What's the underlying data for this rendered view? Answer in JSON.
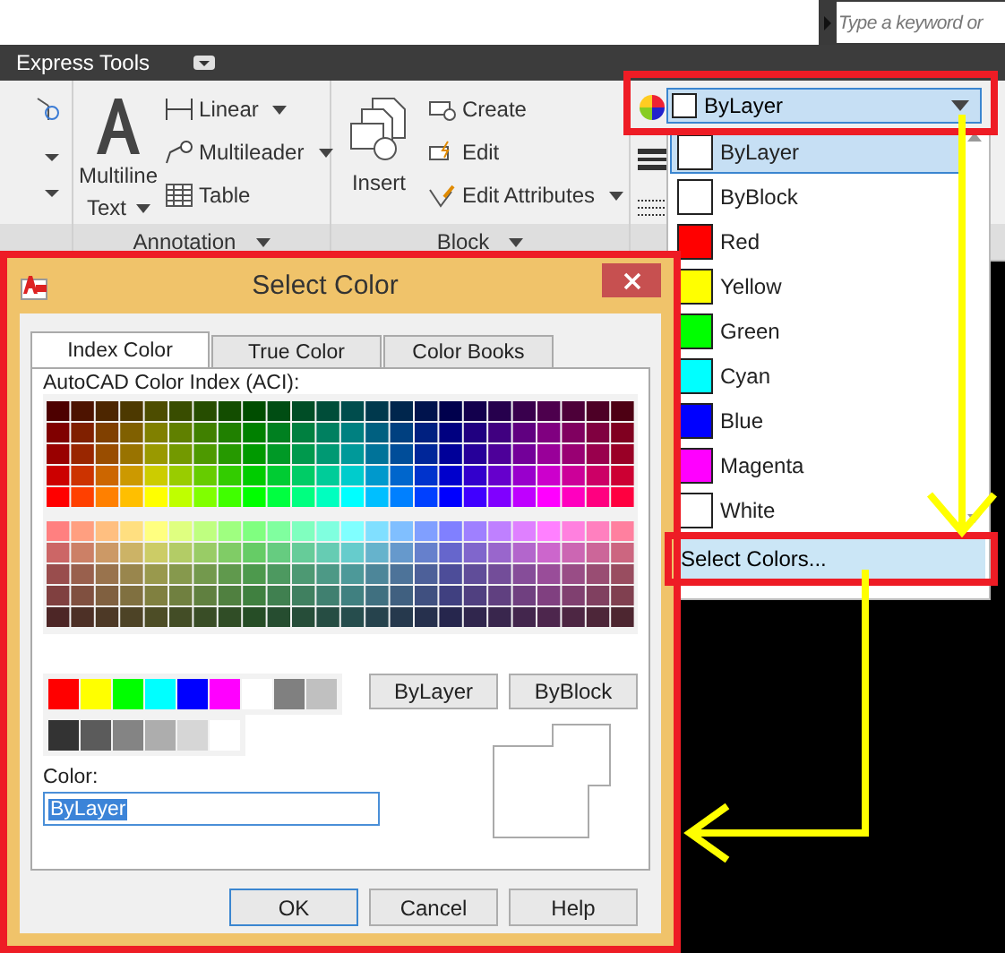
{
  "search": {
    "placeholder": "Type a keyword or"
  },
  "ribbon_tab": {
    "label": "Express Tools"
  },
  "panels": [
    {
      "title": "Annotation",
      "large": {
        "label": "Multiline Text",
        "kind": "text",
        "menu": true
      },
      "tools": [
        {
          "label": "Linear",
          "kind": "dimension",
          "menu": true
        },
        {
          "label": "Multileader",
          "kind": "leader",
          "menu": true
        },
        {
          "label": "Table",
          "kind": "table",
          "menu": false
        }
      ]
    },
    {
      "title": "Block",
      "large": {
        "label": "Insert",
        "kind": "insert",
        "menu": false
      },
      "tools": [
        {
          "label": "Create",
          "kind": "create",
          "menu": false
        },
        {
          "label": "Edit",
          "kind": "edit",
          "menu": false
        },
        {
          "label": "Edit Attributes",
          "kind": "attributes",
          "menu": true
        }
      ]
    }
  ],
  "color_combo": {
    "value": "ByLayer",
    "color": "#ffffff"
  },
  "color_list": {
    "items": [
      {
        "label": "ByLayer",
        "color": "#ffffff",
        "selected": true
      },
      {
        "label": "ByBlock",
        "color": "#ffffff",
        "selected": false
      },
      {
        "label": "Red",
        "color": "#ff0000",
        "selected": false
      },
      {
        "label": "Yellow",
        "color": "#ffff00",
        "selected": false
      },
      {
        "label": "Green",
        "color": "#00ff00",
        "selected": false
      },
      {
        "label": "Cyan",
        "color": "#00ffff",
        "selected": false
      },
      {
        "label": "Blue",
        "color": "#0000ff",
        "selected": false
      },
      {
        "label": "Magenta",
        "color": "#ff00ff",
        "selected": false
      },
      {
        "label": "White",
        "color": "#ffffff",
        "selected": false
      }
    ],
    "footer": {
      "label": "Select Colors...",
      "highlighted": true
    }
  },
  "dialog": {
    "title": "Select Color",
    "tabs": [
      {
        "label": "Index Color",
        "selected": true
      },
      {
        "label": "True Color",
        "selected": false
      },
      {
        "label": "Color Books",
        "selected": false
      }
    ],
    "palette_label": "AutoCAD Color Index (ACI):",
    "standard_colors": [
      {
        "color": "#ff0000"
      },
      {
        "color": "#ffff00"
      },
      {
        "color": "#00ff00"
      },
      {
        "color": "#00ffff"
      },
      {
        "color": "#0000ff"
      },
      {
        "color": "#ff00ff"
      },
      {
        "color": "#ffffff"
      },
      {
        "color": "#808080"
      },
      {
        "color": "#c0c0c0"
      }
    ],
    "gray_shades": [
      {
        "color": "#333333"
      },
      {
        "color": "#5b5b5b"
      },
      {
        "color": "#848484"
      },
      {
        "color": "#adadad"
      },
      {
        "color": "#d6d6d6"
      },
      {
        "color": "#ffffff"
      }
    ],
    "by_buttons": [
      {
        "label": "ByLayer"
      },
      {
        "label": "ByBlock"
      }
    ],
    "color_label": "Color:",
    "color_value": "ByLayer",
    "actions": [
      {
        "label": "OK",
        "default": true
      },
      {
        "label": "Cancel",
        "default": false
      },
      {
        "label": "Help",
        "default": false
      }
    ]
  }
}
